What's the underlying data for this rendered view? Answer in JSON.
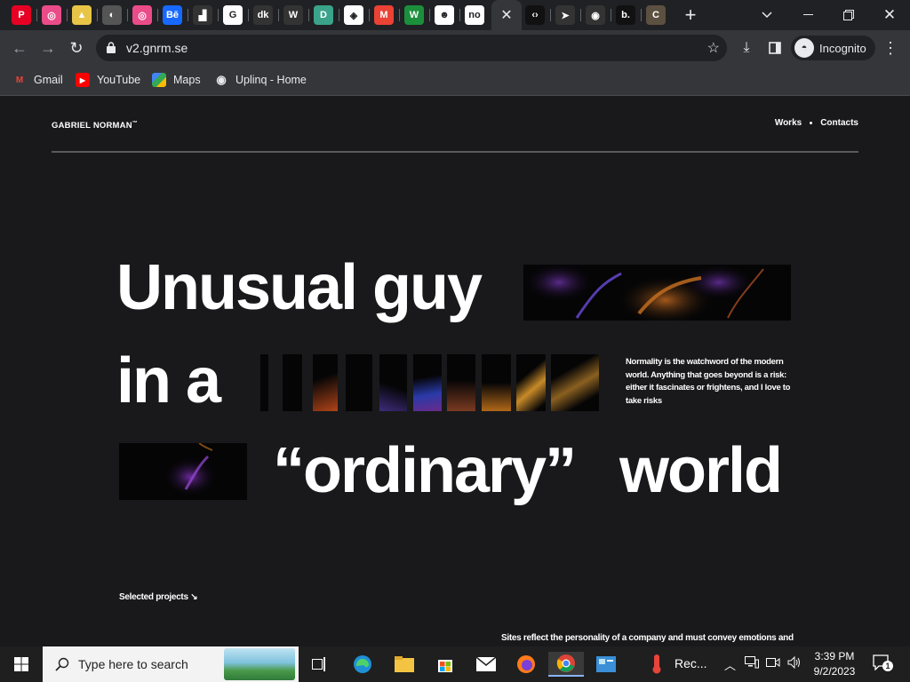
{
  "browser": {
    "tabs": [
      {
        "icon": "pinterest-icon",
        "glyph": "P",
        "color": "#e60023"
      },
      {
        "icon": "dribbble-icon",
        "glyph": "◎",
        "color": "#ea4c89"
      },
      {
        "icon": "colorful-logo-icon",
        "glyph": "▲",
        "color": "#e8c547"
      },
      {
        "icon": "moon-icon",
        "glyph": "◐",
        "color": "#555"
      },
      {
        "icon": "dribbble-icon",
        "glyph": "◎",
        "color": "#ea4c89"
      },
      {
        "icon": "behance-icon",
        "glyph": "Bē",
        "color": "#1769ff"
      },
      {
        "icon": "pixel-icon",
        "glyph": "▟",
        "color": "#333"
      },
      {
        "icon": "google-icon",
        "glyph": "G",
        "color": "#ffffff"
      },
      {
        "icon": "dk-icon",
        "glyph": "dk",
        "color": "#333"
      },
      {
        "icon": "w-logo-icon",
        "glyph": "W",
        "color": "#333"
      },
      {
        "icon": "d-logo-icon",
        "glyph": "D",
        "color": "#3aa38a"
      },
      {
        "icon": "codepen-icon",
        "glyph": "◈",
        "color": "#ffffff"
      },
      {
        "icon": "gmail-icon",
        "glyph": "M",
        "color": "#ea4335"
      },
      {
        "icon": "w-green-icon",
        "glyph": "W",
        "color": "#1c8f3c"
      },
      {
        "icon": "figure-icon",
        "glyph": "☻",
        "color": "#ffffff"
      },
      {
        "icon": "no-logo-icon",
        "glyph": "no",
        "color": "#ffffff"
      },
      {
        "icon": "code-icon",
        "glyph": "‹›",
        "color": "#111"
      },
      {
        "icon": "cursor-icon",
        "glyph": "➤",
        "color": "#333"
      },
      {
        "icon": "uplinq-icon",
        "glyph": "◉",
        "color": "#333"
      },
      {
        "icon": "b-logo-icon",
        "glyph": "b.",
        "color": "#111"
      },
      {
        "icon": "c-logo-icon",
        "glyph": "C",
        "color": "#5c5040"
      }
    ],
    "active_tab_close": "✕",
    "new_tab": "+",
    "url": "v2.gnrm.se",
    "profile_label": "Incognito",
    "bookmarks": [
      {
        "label": "Gmail",
        "icon": "gmail-icon",
        "glyph": "M",
        "color": "#ea4335"
      },
      {
        "label": "YouTube",
        "icon": "youtube-icon",
        "glyph": "▶",
        "color": "#ff0000"
      },
      {
        "label": "Maps",
        "icon": "maps-icon",
        "glyph": "◆",
        "color": "#34a853"
      },
      {
        "label": "Uplinq - Home",
        "icon": "uplinq-icon",
        "glyph": "◉",
        "color": "#35363a"
      }
    ]
  },
  "site": {
    "brand": "GABRIEL NORMAN",
    "brand_mark": "™",
    "nav": {
      "works": "Works",
      "contacts": "Contacts"
    },
    "hero": {
      "line1": "Unusual guy",
      "line2": "in a",
      "line3_word1": "“ordinary”",
      "line3_word2": "world"
    },
    "intro": "Normality is the watchword of the modern world. Anything that goes beyond is a risk: either it fascinates or frightens, and I love to take risks",
    "selected_projects": "Selected projects ↘",
    "bottom_text": "Sites reflect the personality of a company and must convey emotions and"
  },
  "taskbar": {
    "search_placeholder": "Type here to search",
    "recording_label": "Rec...",
    "time": "3:39 PM",
    "date": "9/2/2023",
    "notification_count": "1"
  }
}
